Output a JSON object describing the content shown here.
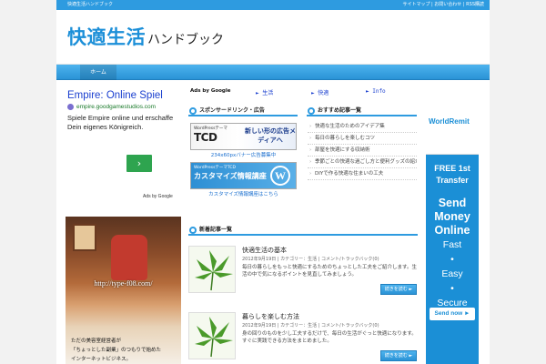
{
  "topbar": {
    "tagline": "快適生活ハンドブック",
    "links": "サイトマップ | お問い合わせ | RSS購読"
  },
  "header": {
    "logo_main": "快適生活",
    "logo_sub": "ハンドブック"
  },
  "nav": {
    "home_label": "ホーム"
  },
  "left_ad": {
    "title": "Empire: Online Spiel",
    "url": "empire.goodgamestudios.com",
    "description": "Spiele Empire online und erschaffe Dein eigenes Königreich.",
    "button_label": "›",
    "ads_by": "Ads by Google"
  },
  "photo_block": {
    "url": "http://type-f08.com/",
    "caption_1": "ただの美容室経営者が",
    "caption_2": "「ちょっとした副業」のつもりで始めた",
    "caption_3": "インターネットビジネス。"
  },
  "ad_links": {
    "ads_by": "Ads by Google",
    "link_1": "► 生活",
    "link_2": "► 快適",
    "link_3": "► Info"
  },
  "sponsor_box": {
    "heading": "スポンサードリンク・広告",
    "banner1_small": "WordPressテーマ",
    "banner1_logo": "TCD",
    "banner1_text": "新しい形の広告メディアへ",
    "banner1_link": "234x60pxバナー広告募集中",
    "banner2_small": "WordPressテーマTCD",
    "banner2_text": "カスタマイズ情報講座",
    "banner2_logo": "W",
    "banner2_link": "カスタマイズ情報講座はこちら"
  },
  "recommended": {
    "heading": "おすすめ記事一覧",
    "items": [
      "快適な生活のためのアイデア集",
      "毎日の暮らしを楽しむコツ",
      "部屋を快適にする収納術",
      "季節ごとの快適な過ごし方と便利グッズの紹介",
      "DIYで作る快適な住まいの工夫"
    ]
  },
  "new_articles": {
    "heading": "新着記事一覧",
    "entries": [
      {
        "title": "快適生活の基本",
        "meta": "2012年9月19日 | カテゴリー：生活 | コメント/トラックバック(0)",
        "body": "毎日の暮らしをもっと快適にするためのちょっとした工夫をご紹介します。生活の中で気になるポイントを見直してみましょう。",
        "more": "続きを読む ►"
      },
      {
        "title": "暮らしを楽しむ方法",
        "meta": "2012年9月19日 | カテゴリー：生活 | コメント/トラックバック(0)",
        "body": "身の回りのものを少し工夫するだけで、毎日の生活がぐっと快適になります。すぐに実践できる方法をまとめました。",
        "more": "続きを読む ►"
      }
    ]
  },
  "right_ad": {
    "brand": "WorldRemit",
    "free_line1": "FREE 1st",
    "free_line2": "Transfer",
    "send_1": "Send",
    "send_2": "Money",
    "send_3": "Online",
    "feat_1": "Fast",
    "feat_2": "•",
    "feat_3": "Easy",
    "feat_4": "•",
    "feat_5": "Secure",
    "button": "Send now ►"
  }
}
